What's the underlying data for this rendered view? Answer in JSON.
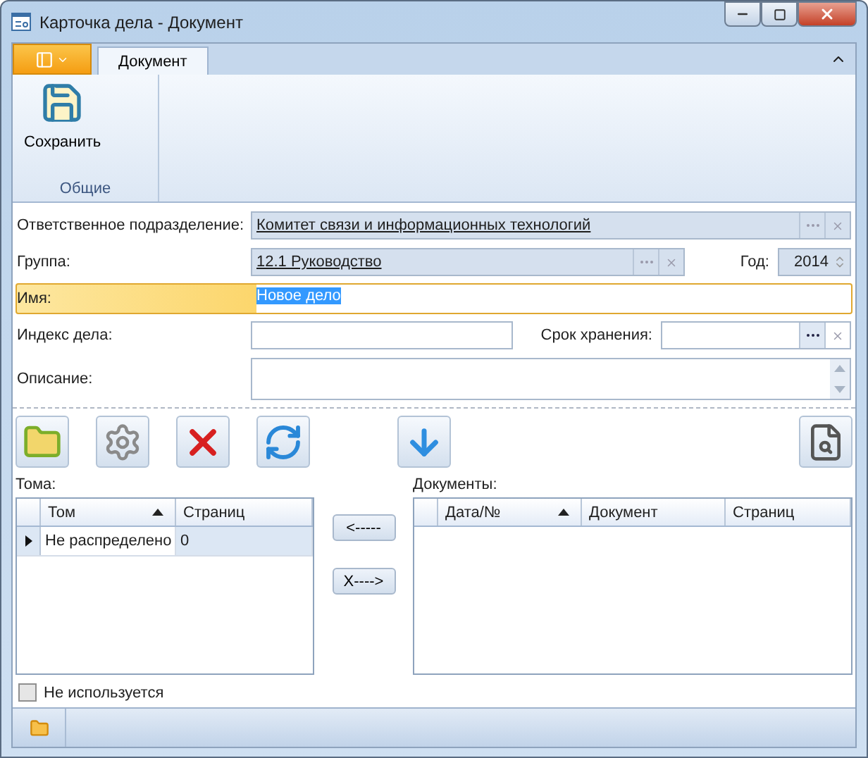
{
  "window": {
    "title": "Карточка дела - Документ"
  },
  "ribbon": {
    "tabs": [
      {
        "label": "Документ",
        "selected": true
      }
    ],
    "groups": [
      {
        "label": "Общие",
        "buttons": [
          {
            "label": "Сохранить"
          }
        ]
      }
    ]
  },
  "form": {
    "department": {
      "label": "Ответственное подразделение:",
      "value": "Комитет связи и информационных технологий"
    },
    "group": {
      "label": "Группа:",
      "value": "12.1 Руководство",
      "year_label": "Год:",
      "year": "2014"
    },
    "name": {
      "label": "Имя:",
      "value": "Новое дело",
      "focused": true
    },
    "index": {
      "label": "Индекс дела:",
      "storage_label": "Срок хранения:"
    },
    "description": {
      "label": "Описание:"
    }
  },
  "toolbar": [
    {
      "kind": "add"
    },
    {
      "kind": "settings"
    },
    {
      "kind": "delete"
    },
    {
      "kind": "refresh"
    },
    {
      "kind": "import"
    },
    {
      "kind": "preview"
    }
  ],
  "volumes": {
    "label": "Тома:",
    "columns": [
      {
        "label": "Том",
        "sorted": true
      },
      {
        "label": "Страниц",
        "sorted": false
      }
    ],
    "rows": [
      {
        "cells": [
          "Не распределено",
          "0"
        ],
        "selected": true
      }
    ]
  },
  "transfer_buttons": [
    "<-----",
    "X---->"
  ],
  "documents": {
    "label": "Документы:",
    "columns": [
      {
        "label": "Дата/№",
        "sorted": true
      },
      {
        "label": "Документ",
        "sorted": false
      },
      {
        "label": "Страниц",
        "sorted": false
      }
    ]
  },
  "unused": {
    "label": "Не используется",
    "checked": false
  }
}
